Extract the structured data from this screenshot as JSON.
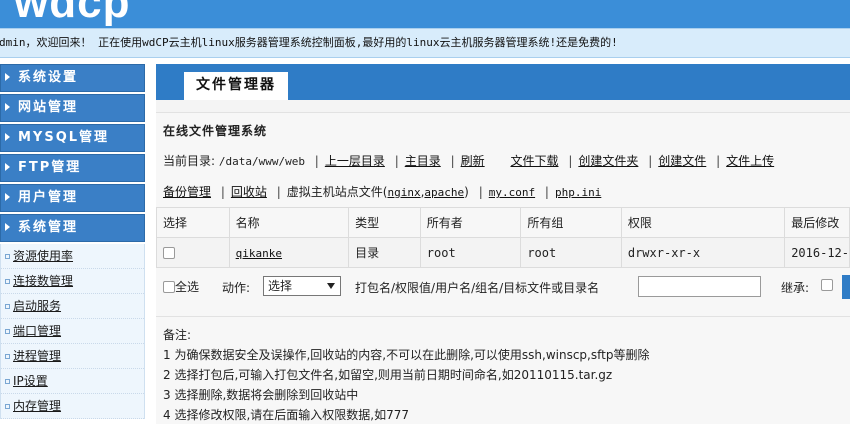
{
  "header": {
    "logo": "wdcp",
    "welcome": "dmin，欢迎回来！ 正在使用wdCP云主机linux服务器管理系统控制面板,最好用的linux云主机服务器管理系统!还是免费的!"
  },
  "sidebar": {
    "menus": [
      {
        "label": "系统设置"
      },
      {
        "label": "网站管理"
      },
      {
        "label": "MYSQL管理"
      },
      {
        "label": "FTP管理"
      },
      {
        "label": "用户管理"
      },
      {
        "label": "系统管理"
      }
    ],
    "sub_items": [
      {
        "label": "资源使用率"
      },
      {
        "label": "连接数管理"
      },
      {
        "label": "启动服务"
      },
      {
        "label": "端口管理"
      },
      {
        "label": "进程管理"
      },
      {
        "label": "IP设置"
      },
      {
        "label": "内存管理"
      }
    ]
  },
  "main": {
    "tab_title": "文件管理器",
    "panel_title": "在线文件管理系统",
    "current_dir_label": "当前目录:",
    "current_dir": "/data/www/web",
    "links_row1": [
      "上一层目录",
      "主目录",
      "刷新",
      "文件下载",
      "创建文件夹",
      "创建文件",
      "文件上传"
    ],
    "links_row2": {
      "backup": "备份管理",
      "recycle": "回收站",
      "vhost_label": "虚拟主机站点文件(",
      "nginx": "nginx",
      "comma": ",",
      "apache": "apache",
      "close": ")",
      "mycnf": "my.conf",
      "phpini": "php.ini"
    },
    "table": {
      "headers": [
        "选择",
        "名称",
        "类型",
        "所有者",
        "所有组",
        "权限",
        "最后修改"
      ],
      "rows": [
        {
          "name": "qikanke",
          "type": "目录",
          "owner": "root",
          "group": "root",
          "perm": "drwxr-xr-x",
          "modified": "2016-12-"
        }
      ]
    },
    "actions": {
      "select_all": "全选",
      "action_label": "动作:",
      "action_value": "选择",
      "pack_label": "打包名/权限值/用户名/组名/目标文件或目录名",
      "inherit_label": "继承:"
    },
    "notes": {
      "title": "备注:",
      "lines": [
        "1 为确保数据安全及误操作,回收站的内容,不可以在此删除,可以使用ssh,winscp,sftp等删除",
        "2 选择打包后,可输入打包文件名,如留空,则用当前日期时间命名,如20110115.tar.gz",
        "3 选择删除,数据将会删除到回收站中",
        "4 选择修改权限,请在后面输入权限数据,如777"
      ]
    }
  }
}
